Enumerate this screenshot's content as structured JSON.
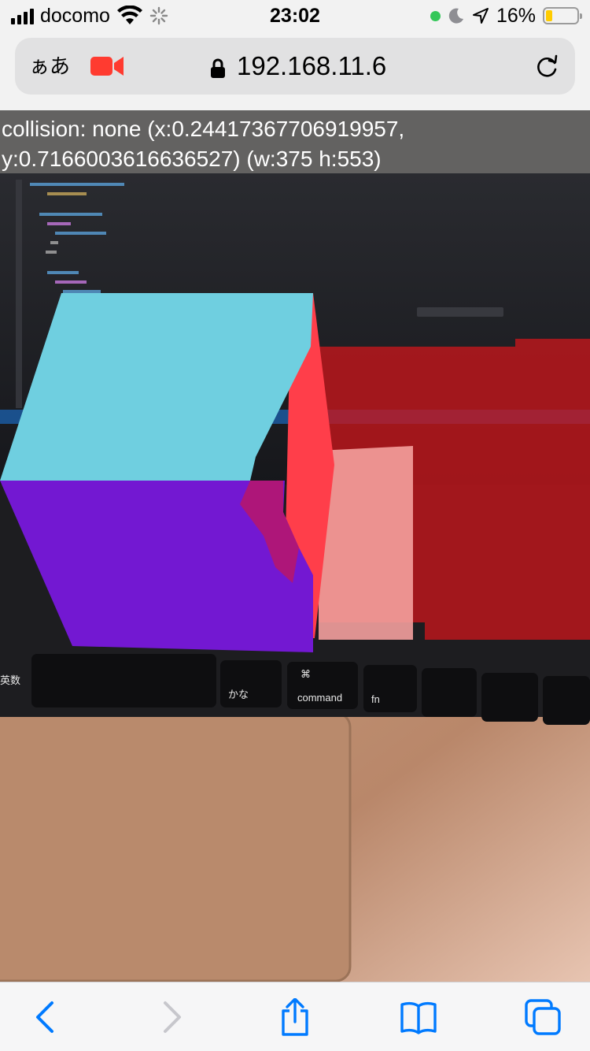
{
  "status_bar": {
    "carrier": "docomo",
    "time": "23:02",
    "battery_percent": "16%",
    "battery_level": 0.16,
    "icons": [
      "signal-icon",
      "wifi-icon",
      "loading-spinner-icon",
      "camera-in-use-dot",
      "moon-icon",
      "location-arrow-icon",
      "battery-icon"
    ]
  },
  "url_bar": {
    "text_size_label": "ぁあ",
    "host": "192.168.11.6",
    "icons": [
      "video-camera-icon",
      "lock-icon",
      "reload-icon"
    ],
    "camera_color": "#ff3b30"
  },
  "ar_view": {
    "collision_line1": "collision: none (x:0.24417367706919957,",
    "collision_line2": "y:0.7166003616636527) (w:375 h:553)",
    "cube_colors": {
      "top": "#6fcfe0",
      "front": "#7318d2",
      "side": "#ff3e4a",
      "overlay": "#c8161b"
    },
    "keyboard_labels": [
      "かな",
      "command",
      "fn",
      "英数",
      "⌘"
    ]
  },
  "toolbar": {
    "items": [
      "back-icon",
      "forward-icon",
      "share-icon",
      "bookmarks-icon",
      "tabs-icon"
    ],
    "accent_color": "#007aff"
  }
}
